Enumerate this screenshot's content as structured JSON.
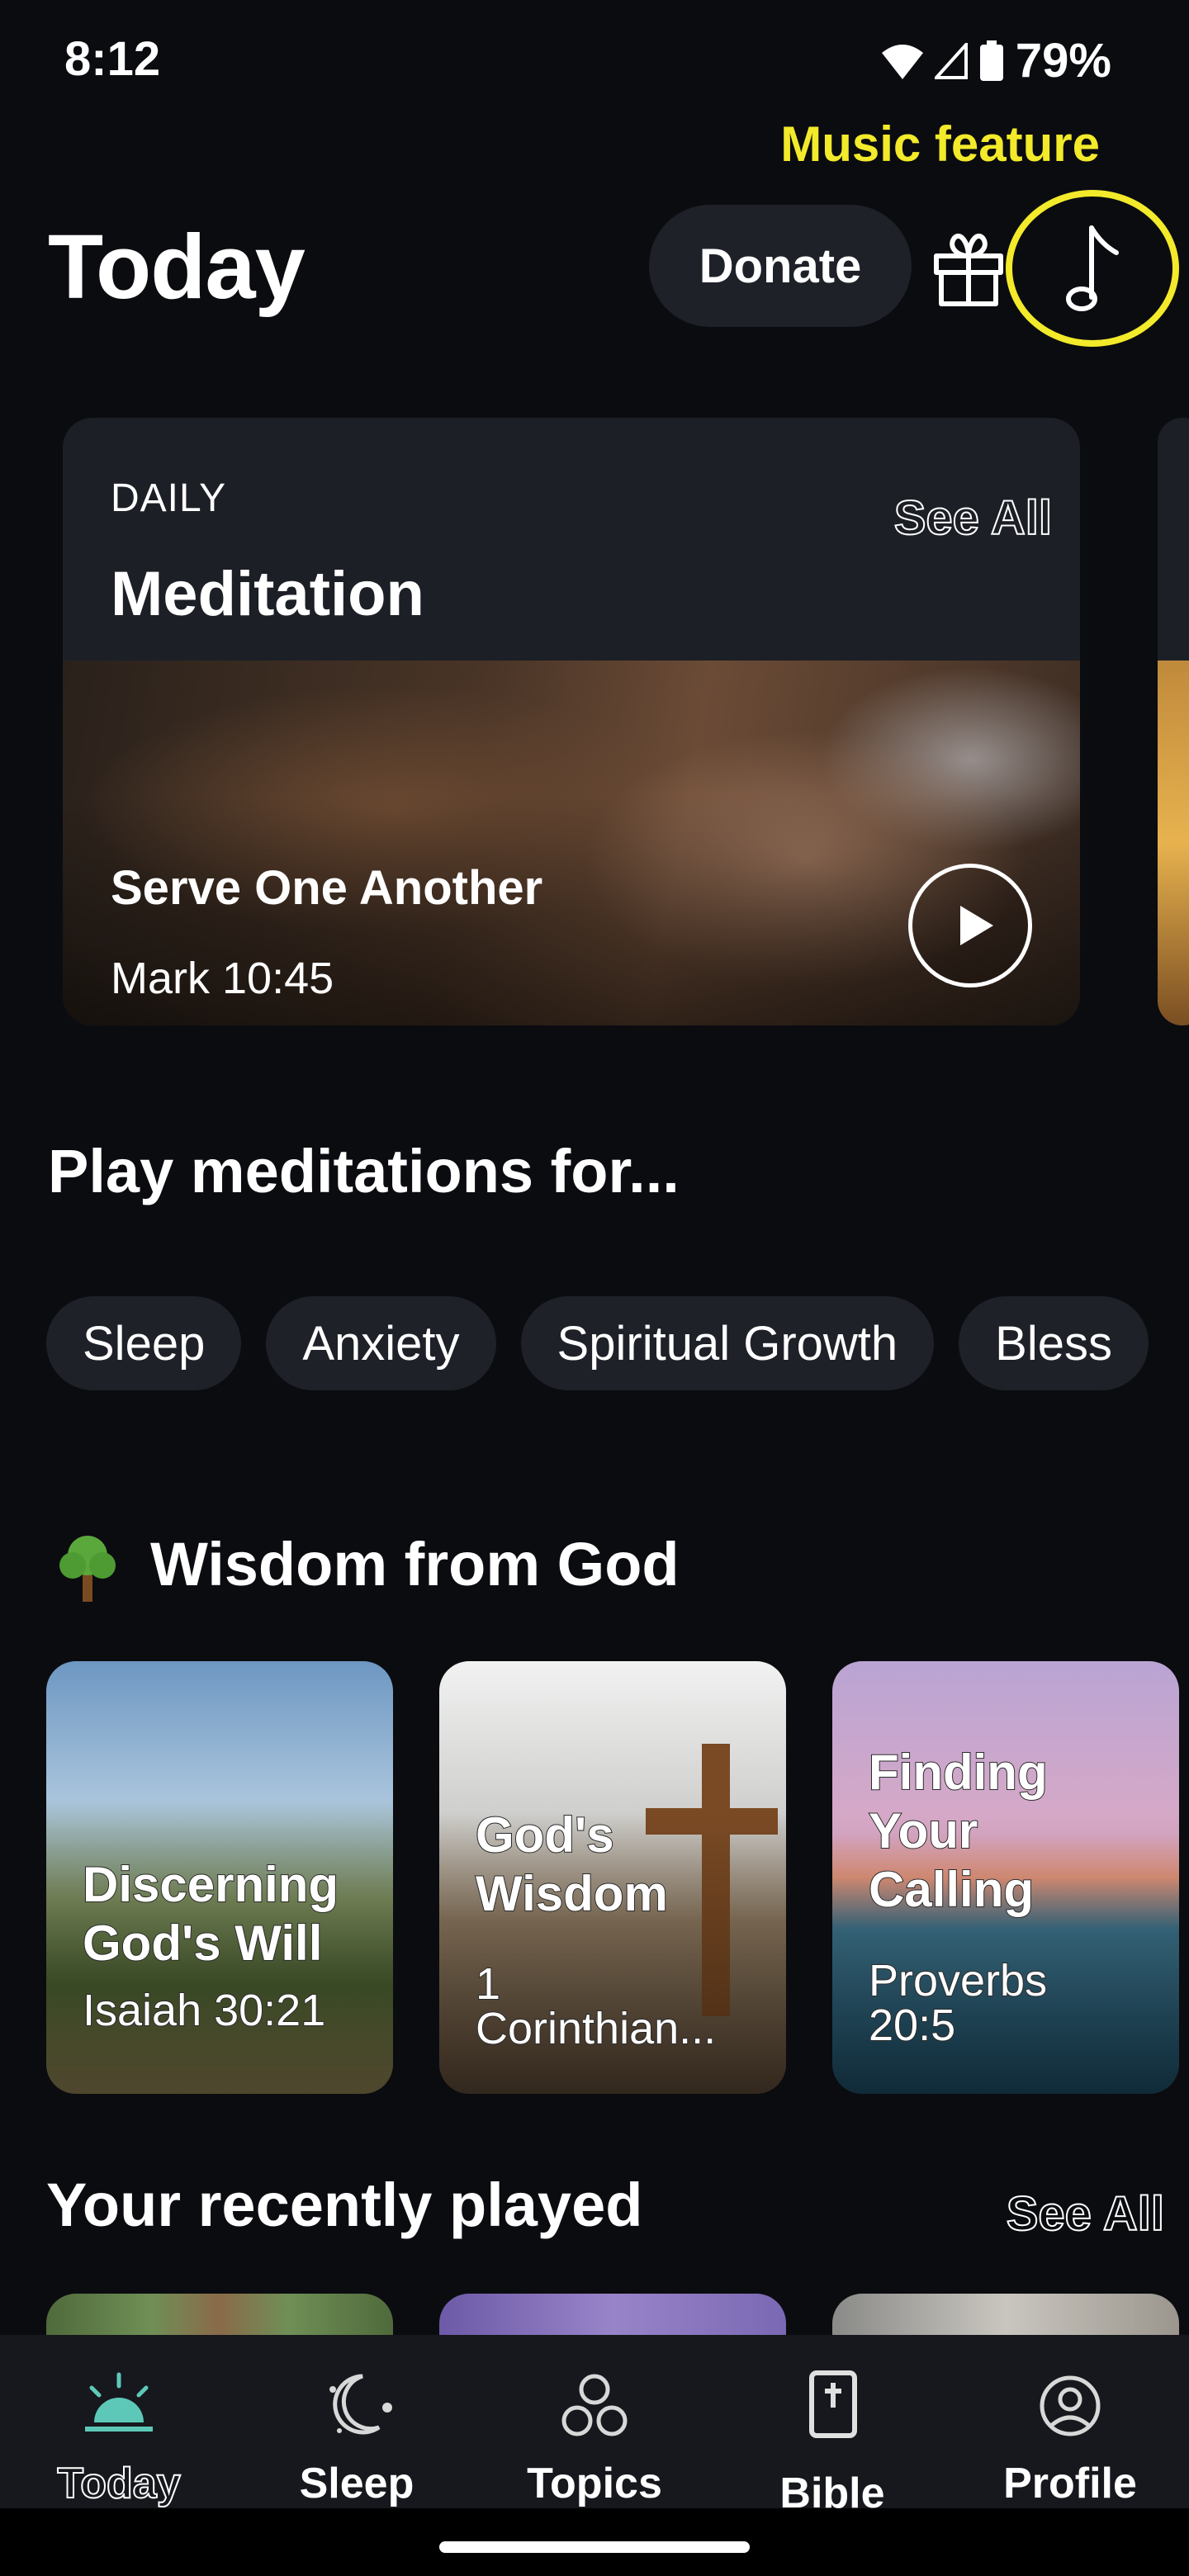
{
  "status_bar": {
    "time": "8:12",
    "battery": "79%"
  },
  "annotation": {
    "text": "Music feature",
    "color": "#f2ea2a"
  },
  "header": {
    "title": "Today",
    "donate_label": "Donate"
  },
  "daily": {
    "label": "DAILY",
    "heading": "Meditation",
    "see_all": "See All",
    "title": "Serve One Another",
    "reference": "Mark 10:45"
  },
  "play_for": {
    "title": "Play meditations for...",
    "chips": [
      "Sleep",
      "Anxiety",
      "Spiritual Growth",
      "Bless"
    ]
  },
  "wisdom": {
    "title": "Wisdom from God",
    "cards": [
      {
        "title_line1": "Discerning",
        "title_line2": "God's Will",
        "ref_line1": "Isaiah 30:21",
        "ref_line2": ""
      },
      {
        "title_line1": "God's",
        "title_line2": "Wisdom",
        "ref_line1": "1",
        "ref_line2": "Corinthian..."
      },
      {
        "title_line1": "Finding",
        "title_line2": "Your",
        "title_line3": "Calling",
        "ref_line1": "Proverbs",
        "ref_line2": "20:5"
      }
    ]
  },
  "recent": {
    "title": "Your recently played",
    "see_all": "See All"
  },
  "nav": {
    "items": [
      "Today",
      "Sleep",
      "Topics",
      "Bible",
      "Profile"
    ],
    "active": "Today",
    "active_color": "#5ec8b8"
  }
}
